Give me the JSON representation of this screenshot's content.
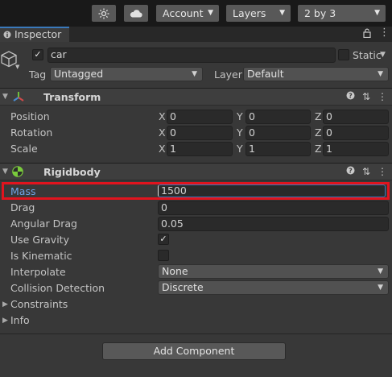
{
  "toolbar": {
    "buttons": [
      {
        "icon": "lighting-settings-icon"
      },
      {
        "icon": "cloud-icon"
      }
    ],
    "account": "Account",
    "layers": "Layers",
    "layout": "2 by 3"
  },
  "tab": {
    "label": "Inspector",
    "icon": "info-icon"
  },
  "object": {
    "active": true,
    "name": "car",
    "static_label": "Static",
    "static_checked": false,
    "tag_label": "Tag",
    "tag_value": "Untagged",
    "layer_label": "Layer",
    "layer_value": "Default"
  },
  "transform": {
    "title": "Transform",
    "rows": [
      {
        "label": "Position",
        "x": "0",
        "y": "0",
        "z": "0"
      },
      {
        "label": "Rotation",
        "x": "0",
        "y": "0",
        "z": "0"
      },
      {
        "label": "Scale",
        "x": "1",
        "y": "1",
        "z": "1"
      }
    ],
    "axes": [
      "X",
      "Y",
      "Z"
    ]
  },
  "rigidbody": {
    "title": "Rigidbody",
    "mass_label": "Mass",
    "mass_value": "1500",
    "drag_label": "Drag",
    "drag_value": "0",
    "angular_drag_label": "Angular Drag",
    "angular_drag_value": "0.05",
    "use_gravity_label": "Use Gravity",
    "use_gravity": true,
    "is_kinematic_label": "Is Kinematic",
    "is_kinematic": false,
    "interpolate_label": "Interpolate",
    "interpolate_value": "None",
    "collision_label": "Collision Detection",
    "collision_value": "Discrete",
    "constraints_label": "Constraints",
    "info_label": "Info"
  },
  "add_component": "Add Component",
  "colors": {
    "highlight": "#e1141e",
    "accent": "#3a79bb"
  }
}
